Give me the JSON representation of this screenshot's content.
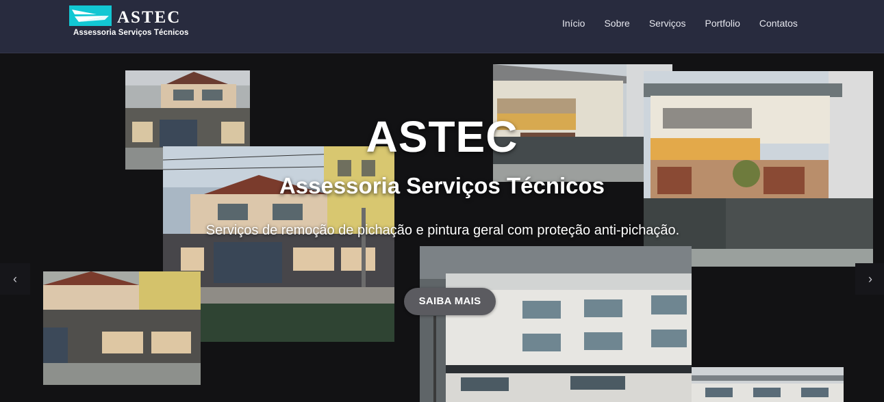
{
  "brand": {
    "name": "ASTEC",
    "tagline": "Assessoria Serviços Técnicos",
    "logo_color": "#12c7d3"
  },
  "nav": {
    "items": [
      "Início",
      "Sobre",
      "Serviços",
      "Portfolio",
      "Contatos"
    ]
  },
  "hero": {
    "title": "ASTEC",
    "subtitle": "Assessoria Serviços Técnicos",
    "description": "Serviços de remoção de pichação e pintura geral com proteção anti-pichação.",
    "cta_label": "SAIBA MAIS",
    "prev_icon": "‹",
    "next_icon": "›"
  },
  "colors": {
    "header_bg": "#282b3e",
    "hero_bg": "#121214",
    "cta_bg": "#5b5b60"
  }
}
